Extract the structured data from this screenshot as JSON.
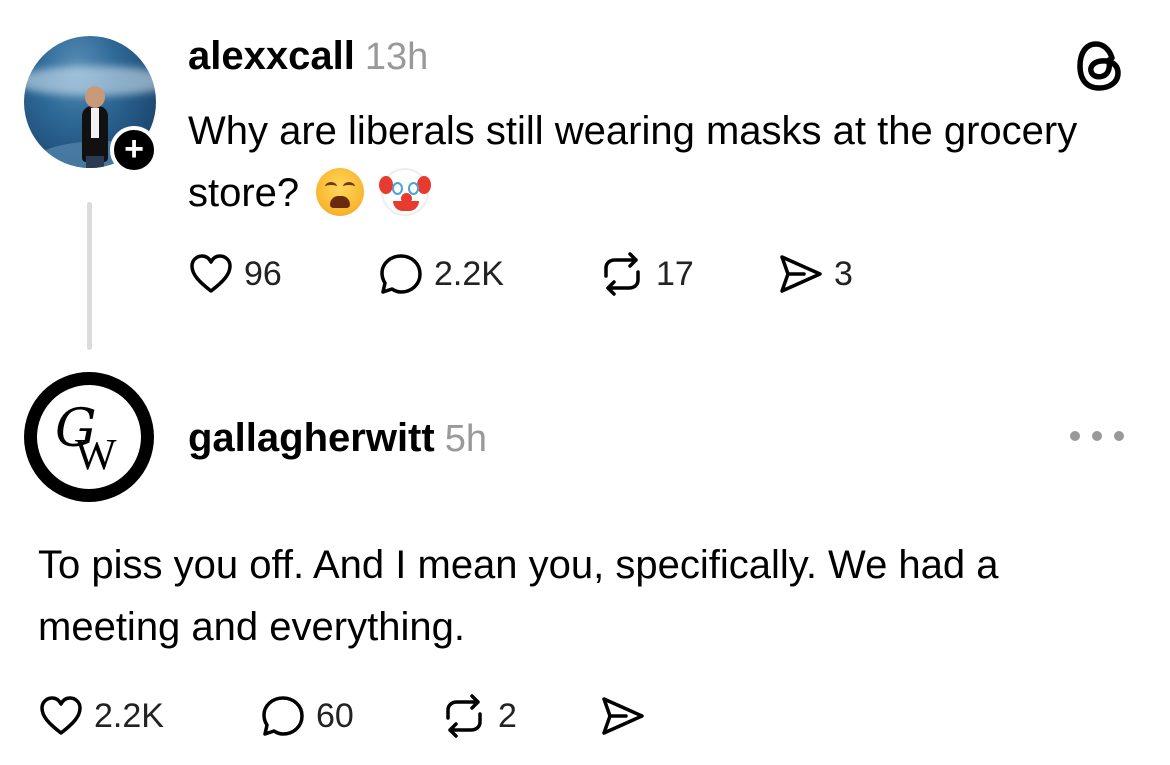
{
  "post1": {
    "username": "alexxcall",
    "timestamp": "13h",
    "text": "Why are liberals still wearing masks at the grocery store?",
    "emojis": [
      "weary-face",
      "clown-face"
    ],
    "follow_badge": "+",
    "counts": {
      "likes": "96",
      "replies": "2.2K",
      "reposts": "17",
      "shares": "3"
    }
  },
  "post2": {
    "username": "gallagherwitt",
    "timestamp": "5h",
    "avatar_letters": {
      "top": "G",
      "bottom": "W"
    },
    "text": "To piss you off. And I mean you, specifically. We had a meeting and everything.",
    "counts": {
      "likes": "2.2K",
      "replies": "60",
      "reposts": "2"
    }
  },
  "icons": [
    "heart-icon",
    "comment-icon",
    "repost-icon",
    "send-icon",
    "threads-logo-icon",
    "more-icon"
  ]
}
